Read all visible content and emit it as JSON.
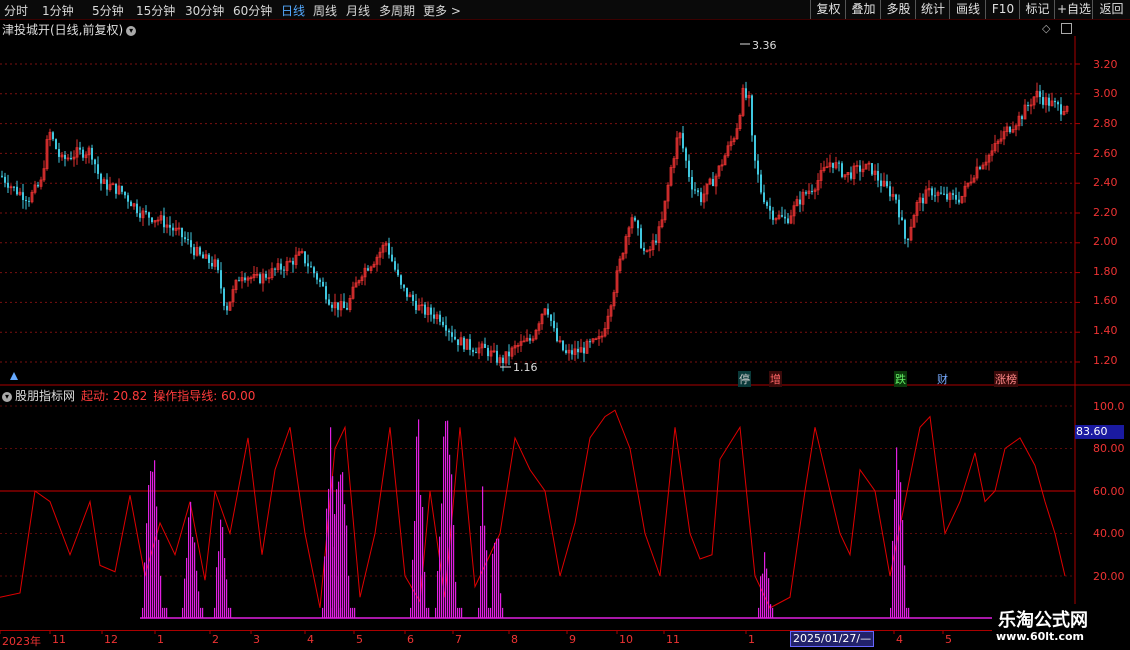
{
  "toolbar": {
    "left": [
      "分时",
      "1分钟",
      "5分钟",
      "15分钟",
      "30分钟",
      "60分钟",
      "日线",
      "周线",
      "月线",
      "多周期",
      "更多 >"
    ],
    "active": "日线",
    "right": [
      "复权",
      "叠加",
      "多股",
      "统计",
      "画线",
      "F10",
      "标记",
      "+自选",
      "返回"
    ]
  },
  "main_title": "津投城开(日线,前复权)",
  "main_axis": [
    "3.20",
    "3.00",
    "2.80",
    "2.60",
    "2.40",
    "2.20",
    "2.00",
    "1.80",
    "1.60",
    "1.40",
    "1.20"
  ],
  "high_label": "3.36",
  "low_label": "1.16",
  "markers": [
    {
      "text": "停",
      "color": "#4ad"
    },
    {
      "text": "增",
      "color": "#e44"
    },
    {
      "text": "跌",
      "color": "#4d4"
    },
    {
      "text": "财",
      "color": "#7af"
    },
    {
      "text": "涨榜",
      "color": "#e44"
    }
  ],
  "sub_title": {
    "name": "股朋指标网",
    "v1": "起动: 20.82",
    "v2": "操作指导线: 60.00"
  },
  "sub_axis": [
    "100.0",
    "80.00",
    "60.00",
    "40.00",
    "20.00"
  ],
  "sub_current": "83.60",
  "time_axis": [
    "2023年",
    "11",
    "12",
    "1",
    "2",
    "3",
    "4",
    "5",
    "6",
    "7",
    "8",
    "9",
    "10",
    "11",
    "1",
    "4",
    "5"
  ],
  "date_box": "2025/01/27/—",
  "watermark": {
    "line1": "乐淘公式网",
    "line2": "www.60lt.com"
  },
  "colors": {
    "up": "#e03030",
    "down": "#40c8e0",
    "line": "#e00000",
    "bar": "#e020e0",
    "guide": "#cc0000"
  }
}
